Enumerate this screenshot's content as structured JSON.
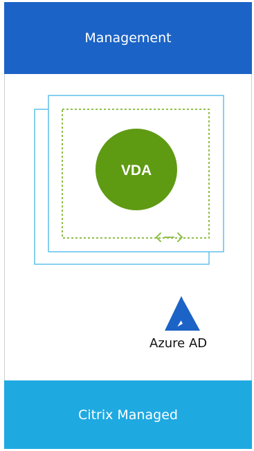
{
  "header": {
    "label": "Management"
  },
  "vda": {
    "label": "VDA"
  },
  "azure": {
    "label": "Azure AD",
    "icon": "azure-icon"
  },
  "footer": {
    "label": "Citrix Managed"
  },
  "colors": {
    "header_bg": "#1b63c6",
    "footer_bg": "#1fa9e1",
    "vm_border": "#5fc0ea",
    "vda_green": "#5f9a13",
    "dashed_green": "#8dbf46",
    "azure_blue": "#1b63c6"
  }
}
